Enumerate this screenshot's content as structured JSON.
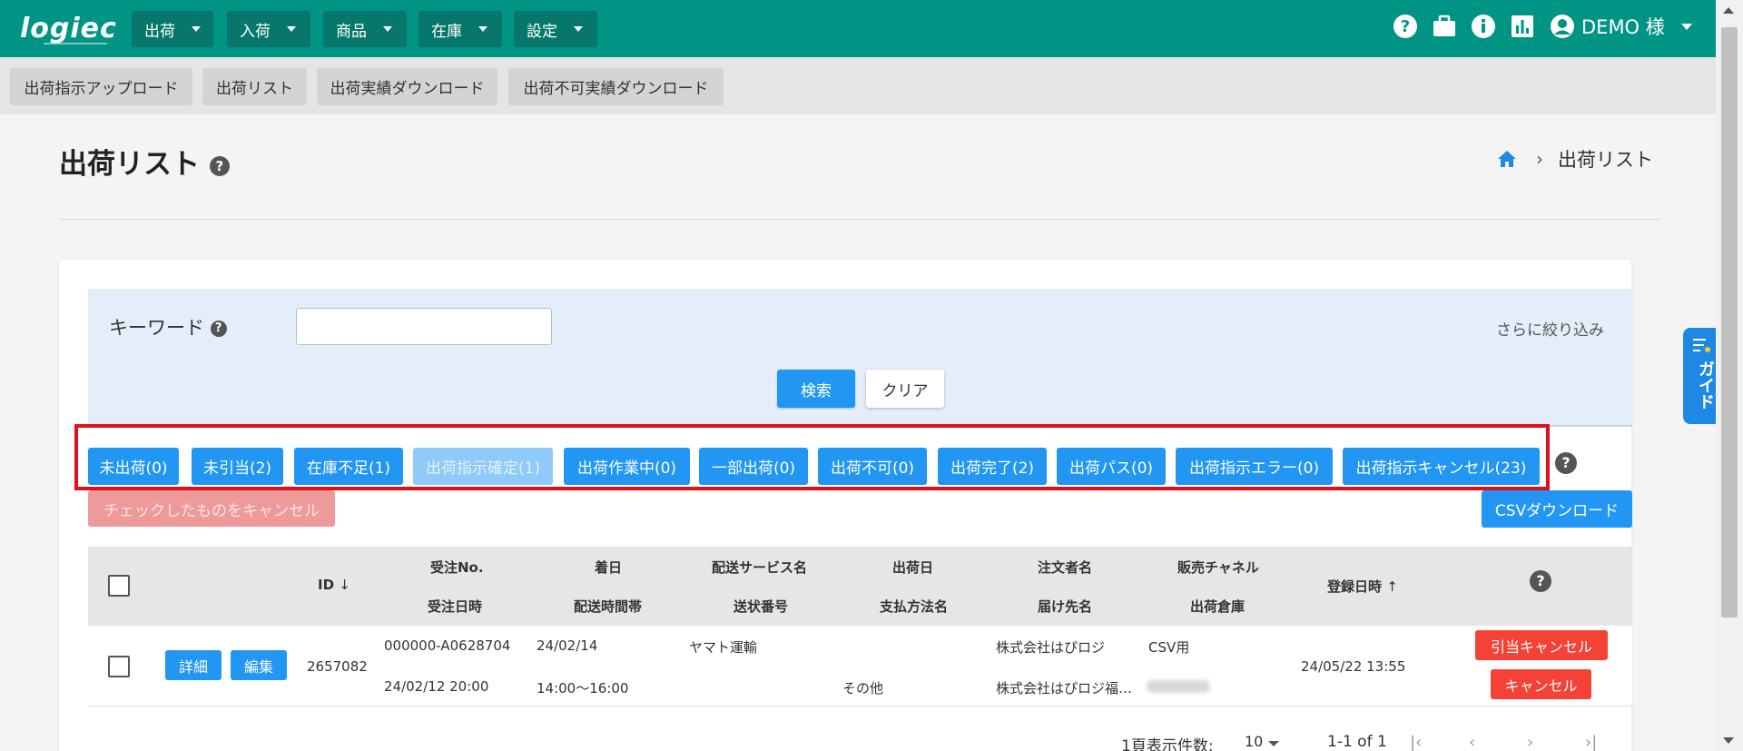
{
  "header": {
    "logo": "logiec",
    "menus": [
      {
        "label": "出荷"
      },
      {
        "label": "入荷"
      },
      {
        "label": "商品"
      },
      {
        "label": "在庫"
      },
      {
        "label": "設定"
      }
    ],
    "user": "DEMO 様"
  },
  "subnav": [
    {
      "label": "出荷指示アップロード"
    },
    {
      "label": "出荷リスト"
    },
    {
      "label": "出荷実績ダウンロード"
    },
    {
      "label": "出荷不可実績ダウンロード"
    }
  ],
  "page": {
    "title": "出荷リスト",
    "breadcrumb_current": "出荷リスト"
  },
  "search": {
    "keyword_label": "キーワード",
    "keyword_value": "",
    "more_filter": "さらに絞り込み",
    "search_button": "検索",
    "clear_button": "クリア"
  },
  "status_filters": [
    {
      "label": "未出荷(0)"
    },
    {
      "label": "未引当(2)"
    },
    {
      "label": "在庫不足(1)"
    },
    {
      "label": "出荷指示確定(1)"
    },
    {
      "label": "出荷作業中(0)"
    },
    {
      "label": "一部出荷(0)"
    },
    {
      "label": "出荷不可(0)"
    },
    {
      "label": "出荷完了(2)"
    },
    {
      "label": "出荷パス(0)"
    },
    {
      "label": "出荷指示エラー(0)"
    },
    {
      "label": "出荷指示キャンセル(23)"
    }
  ],
  "actions": {
    "cancel_checked": "チェックしたものをキャンセル",
    "csv_download": "CSVダウンロード"
  },
  "table": {
    "headers": {
      "id": "ID",
      "order_no": "受注No.",
      "order_datetime": "受注日時",
      "arrival_date": "着日",
      "delivery_time": "配送時間帯",
      "delivery_service": "配送サービス名",
      "tracking_no": "送状番号",
      "ship_date": "出荷日",
      "payment_method": "支払方法名",
      "orderer": "注文者名",
      "recipient": "届け先名",
      "sales_channel": "販売チャネル",
      "warehouse": "出荷倉庫",
      "registered_at": "登録日時"
    },
    "rows": [
      {
        "detail_button": "詳細",
        "edit_button": "編集",
        "id": "2657082",
        "order_no": "000000-A0628704",
        "order_datetime": "24/02/12 20:00",
        "arrival_date": "24/02/14",
        "delivery_time": "14:00～16:00",
        "delivery_service": "ヤマト運輸",
        "tracking_no": "",
        "ship_date": "",
        "payment_method": "その他",
        "orderer": "株式会社はぴロジ",
        "recipient": "株式会社はぴロジ福…",
        "sales_channel": "CSV用",
        "registered_at": "24/05/22 13:55",
        "release_cancel_button": "引当キャンセル",
        "cancel_button": "キャンセル"
      }
    ]
  },
  "pagination": {
    "per_page_label": "1頁表示件数:",
    "per_page_value": "10",
    "range": "1-1 of 1"
  },
  "guide": {
    "label": "ガイド"
  },
  "colors": {
    "header": "#009485",
    "primary": "#2196f3",
    "danger": "#f44336",
    "highlight_box": "#e0101a"
  }
}
